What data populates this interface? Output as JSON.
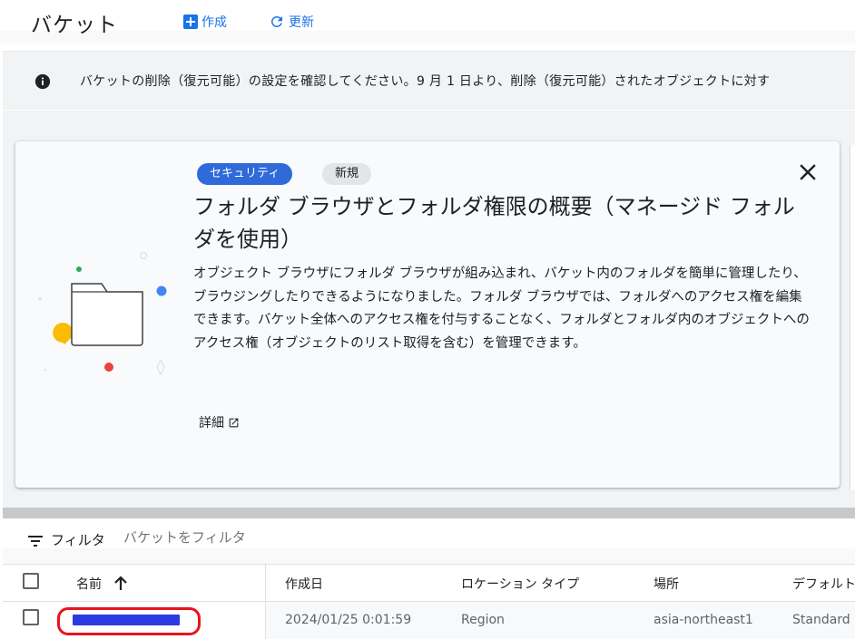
{
  "header": {
    "title": "バケット",
    "create_label": "作成",
    "refresh_label": "更新"
  },
  "banner": {
    "text": "バケットの削除（復元可能）の設定を確認してください。9 月 1 日より、削除（復元可能）されたオブジェクトに対す"
  },
  "promo": {
    "chip_security": "セキュリティ",
    "chip_new": "新規",
    "title": "フォルダ ブラウザとフォルダ権限の概要（マネージド フォルダを使用）",
    "body": "オブジェクト ブラウザにフォルダ ブラウザが組み込まれ、バケット内のフォルダを簡単に管理したり、ブラウジングしたりできるようになりました。フォルダ ブラウザでは、フォルダへのアクセス権を編集できます。バケット全体へのアクセス権を付与することなく、フォルダとフォルダ内のオブジェクトへのアクセス権（オブジェクトのリスト取得を含む）を管理できます。",
    "details_label": "詳細"
  },
  "filter": {
    "label": "フィルタ",
    "placeholder": "バケットをフィルタ"
  },
  "table": {
    "columns": [
      "名前",
      "作成日",
      "ロケーション タイプ",
      "場所",
      "デフォルト"
    ],
    "rows": [
      {
        "name": "",
        "created": "2024/01/25 0:01:59",
        "location_type": "Region",
        "location": "asia-northeast1",
        "default_class": "Standard"
      }
    ]
  },
  "colors": {
    "accent": "#1a73e8",
    "chip_security": "#2f6ad9",
    "highlight_annotation": "#e8141c",
    "redaction": "#2b3be0"
  },
  "icons": [
    "add-box-icon",
    "refresh-icon",
    "info-icon",
    "close-icon",
    "external-link-icon",
    "filter-list-icon",
    "arrow-up-icon",
    "folder-icon"
  ]
}
